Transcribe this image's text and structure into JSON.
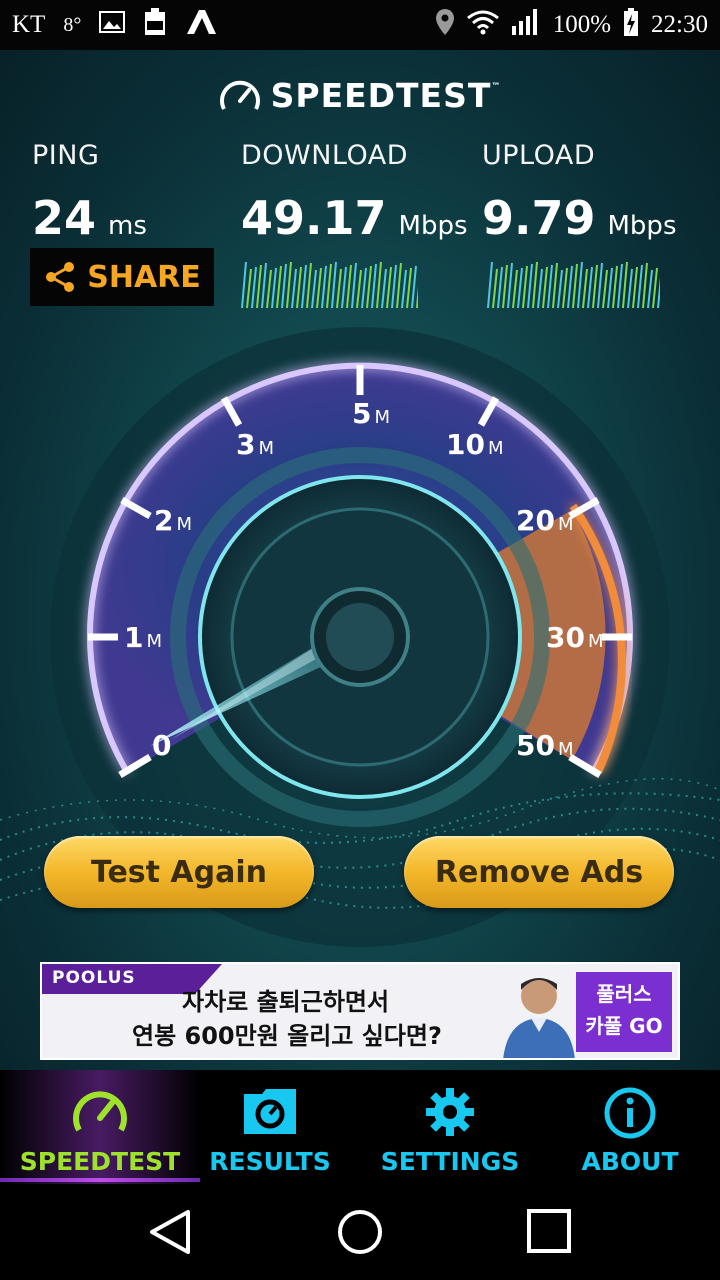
{
  "status_bar": {
    "carrier": "KT",
    "temperature": "8°",
    "battery": "100%",
    "time": "22:30",
    "icons": [
      "image-icon",
      "battery-saver-100-icon",
      "app-a-icon",
      "location-icon",
      "wifi-icon",
      "signal-icon",
      "battery-charging-icon"
    ]
  },
  "header": {
    "logo_text": "SPEEDTEST",
    "trademark": "™"
  },
  "results": {
    "ping": {
      "label": "PING",
      "value": "24",
      "unit": "ms"
    },
    "download": {
      "label": "DOWNLOAD",
      "value": "49.17",
      "unit": "Mbps"
    },
    "upload": {
      "label": "UPLOAD",
      "value": "9.79",
      "unit": "Mbps"
    }
  },
  "share_button": {
    "label": "SHARE"
  },
  "gauge": {
    "ticks": [
      {
        "num": "0",
        "unit": ""
      },
      {
        "num": "1",
        "unit": "M"
      },
      {
        "num": "2",
        "unit": "M"
      },
      {
        "num": "3",
        "unit": "M"
      },
      {
        "num": "5",
        "unit": "M"
      },
      {
        "num": "10",
        "unit": "M"
      },
      {
        "num": "20",
        "unit": "M"
      },
      {
        "num": "30",
        "unit": "M"
      },
      {
        "num": "50",
        "unit": "M"
      }
    ],
    "needle_value": 0
  },
  "buttons": {
    "test_again": "Test Again",
    "remove_ads": "Remove Ads"
  },
  "ad": {
    "brand": "POOLUS",
    "line1": "자차로 출퇴근하면서",
    "line2": "연봉 600만원 올리고 싶다면?",
    "cta_line1": "풀러스",
    "cta_line2": "카풀 GO"
  },
  "nav": [
    {
      "label": "SPEEDTEST",
      "icon": "speedometer-icon",
      "active": true
    },
    {
      "label": "RESULTS",
      "icon": "results-folder-icon",
      "active": false
    },
    {
      "label": "SETTINGS",
      "icon": "gear-icon",
      "active": false
    },
    {
      "label": "ABOUT",
      "icon": "info-icon",
      "active": false
    }
  ],
  "colors": {
    "accent_cyan": "#19c8f0",
    "active_green": "#9fe22b",
    "share_orange": "#f5a623",
    "button_gold": "#f3b72a"
  }
}
